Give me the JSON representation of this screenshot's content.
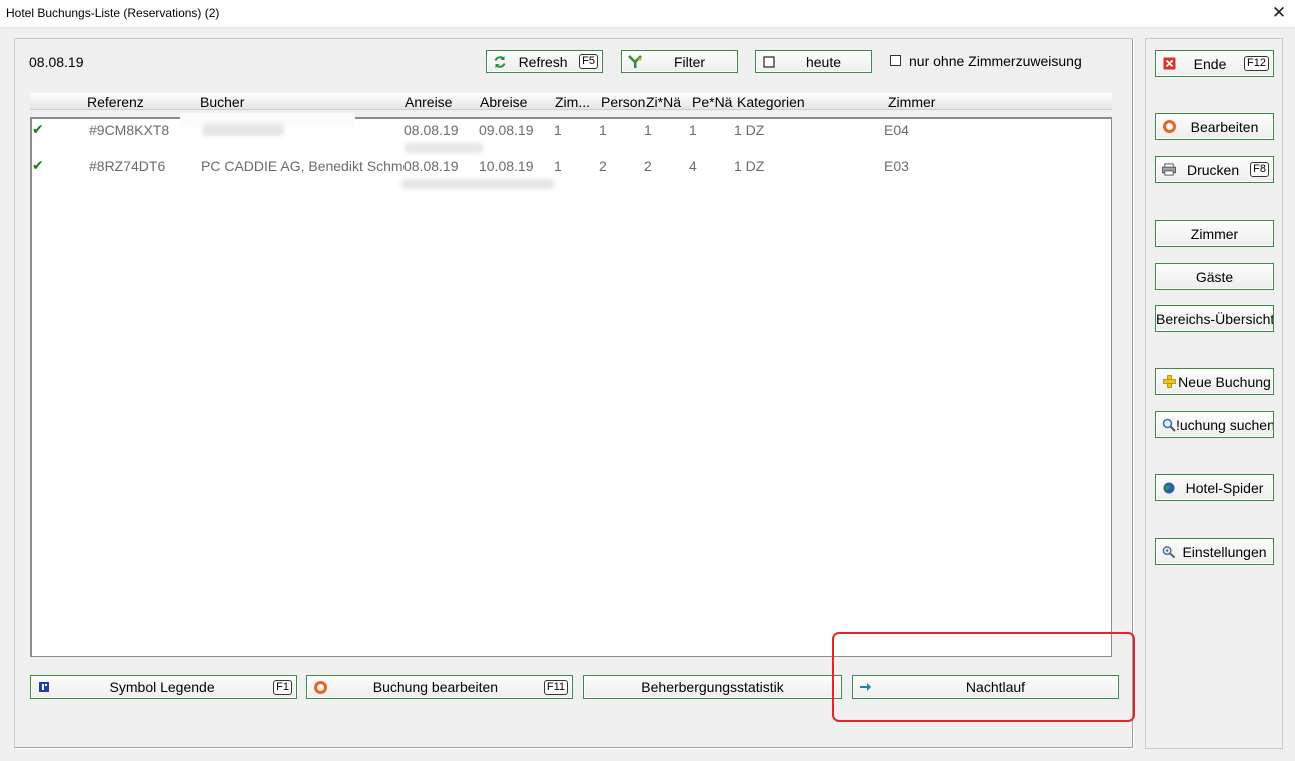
{
  "window": {
    "title": "Hotel Buchungs-Liste (Reservations) (2)",
    "close_glyph": "✕"
  },
  "toolbar": {
    "date": "08.08.19",
    "refresh": {
      "label": "Refresh",
      "key": "F5",
      "icon": "refresh-icon"
    },
    "filter": {
      "label": "Filter",
      "icon": "filter-icon"
    },
    "heute": {
      "label": "heute",
      "icon": "checkbox-icon"
    },
    "nur_ohne_checkbox": {
      "label": "nur ohne Zimmerzuweisung",
      "checked": false
    }
  },
  "list": {
    "columns": [
      "Referenz",
      "Bucher",
      "Anreise",
      "Abreise",
      "Zim...",
      "Person",
      "Zi*Nä",
      "Pe*Nä",
      "Kategorien",
      "Zimmer"
    ],
    "rows": [
      {
        "status_glyph": "✔",
        "referenz": "#9CM8KXT8",
        "bucher": "",
        "anreise": "08.08.19",
        "abreise": "09.08.19",
        "zim": "1",
        "person": "1",
        "zi_nae": "1",
        "pe_nae": "1",
        "kategorien": "1 DZ",
        "zimmer": "E04"
      },
      {
        "status_glyph": "✔",
        "referenz": "#8RZ74DT6",
        "bucher": "PC CADDIE AG, Benedikt Schmec",
        "anreise": "08.08.19",
        "abreise": "10.08.19",
        "zim": "1",
        "person": "2",
        "zi_nae": "2",
        "pe_nae": "4",
        "kategorien": "1 DZ",
        "zimmer": "E03"
      }
    ]
  },
  "bottom_bar": {
    "symbol_legende": {
      "label": "Symbol Legende",
      "key": "F1",
      "icon": "legend-icon"
    },
    "buchung_bearbeiten": {
      "label": "Buchung bearbeiten",
      "key": "F11",
      "icon": "lifebuoy-icon"
    },
    "beherbergungsstatistik": {
      "label": "Beherbergungsstatistik"
    },
    "nachtlauf": {
      "label": "Nachtlauf",
      "icon": "arrow-right-icon"
    }
  },
  "sidebar": {
    "ende": {
      "label": "Ende",
      "key": "F12",
      "icon": "close-red-icon"
    },
    "bearbeiten": {
      "label": "Bearbeiten",
      "icon": "lifebuoy-icon"
    },
    "drucken": {
      "label": "Drucken",
      "key": "F8",
      "icon": "printer-icon"
    },
    "zimmer": {
      "label": "Zimmer"
    },
    "gaeste": {
      "label": "Gäste"
    },
    "bereichs": {
      "label": "Bereichs-Übersicht"
    },
    "neue_buchung": {
      "label": "Neue Buchung",
      "icon": "plus-icon"
    },
    "buchung_suchen": {
      "label": "!uchung suchen",
      "icon": "search-icon"
    },
    "hotel_spider": {
      "label": "Hotel-Spider",
      "icon": "globe-icon"
    },
    "einstellungen": {
      "label": "Einstellungen",
      "icon": "settings-icon"
    }
  },
  "colors": {
    "button_border": "#3f8a4a",
    "check_green": "#1f7a1f",
    "highlight_red": "#e0262a",
    "row_text": "#6b6b6b"
  }
}
